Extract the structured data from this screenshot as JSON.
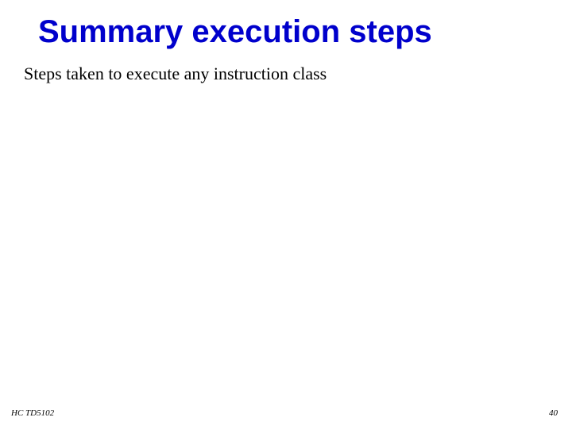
{
  "slide": {
    "title": "Summary execution steps",
    "subtitle": "Steps taken to execute any instruction class",
    "footer_left": "HC TD5102",
    "footer_right": "40"
  }
}
